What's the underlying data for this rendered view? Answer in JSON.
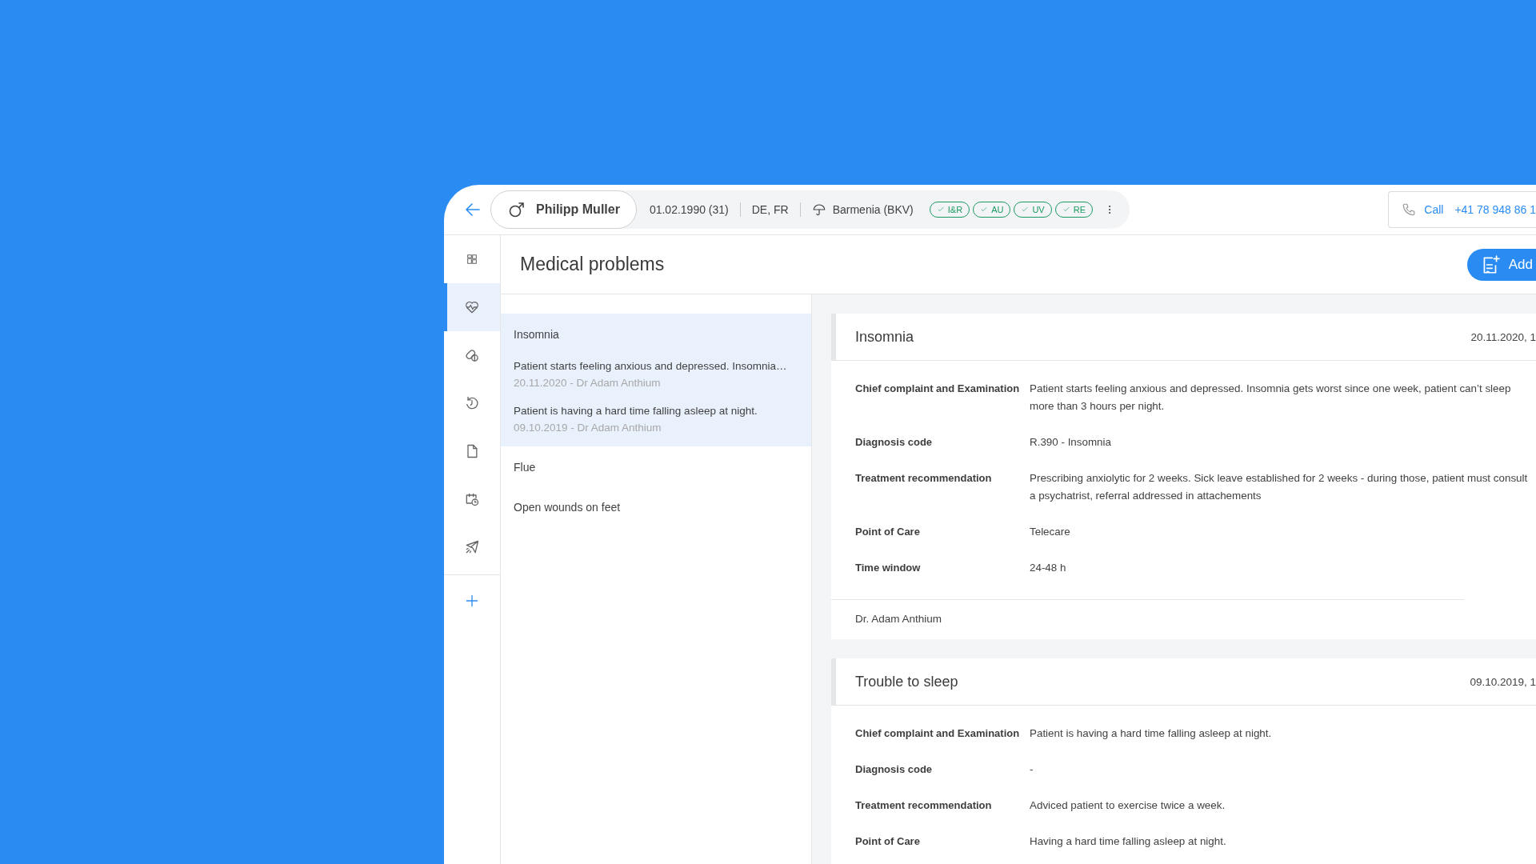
{
  "patient": {
    "name": "Philipp Muller",
    "birth": "01.02.1990 (31)",
    "languages": "DE, FR",
    "insurance": "Barmenia (BKV)",
    "badges": [
      "I&R",
      "AU",
      "UV",
      "RE"
    ]
  },
  "call": {
    "label": "Call",
    "number": "+41 78 948 86 1"
  },
  "sidebar": {
    "items": [
      {
        "kind": "dashboard",
        "selected": false
      },
      {
        "kind": "health",
        "selected": true
      },
      {
        "kind": "pills",
        "selected": false
      },
      {
        "kind": "history",
        "selected": false
      },
      {
        "kind": "document",
        "selected": false
      },
      {
        "kind": "schedule",
        "selected": false
      },
      {
        "kind": "travel",
        "selected": false
      }
    ]
  },
  "page": {
    "title": "Medical problems",
    "add_button": "Add"
  },
  "problems": [
    {
      "title": "Insomnia",
      "selected": true,
      "entries": [
        {
          "text": "Patient starts feeling anxious and depressed. Insomnia…",
          "meta": "20.11.2020 - Dr Adam Anthium"
        },
        {
          "text": "Patient is having a hard time falling asleep at night.",
          "meta": "09.10.2019 - Dr Adam Anthium"
        }
      ]
    },
    {
      "title": "Flue",
      "selected": false
    },
    {
      "title": "Open wounds on feet",
      "selected": false
    }
  ],
  "records": [
    {
      "title": "Insomnia",
      "date": "20.11.2020, 1",
      "author": "Dr. Adam Anthium",
      "fields": [
        {
          "label": "Chief complaint and Examination",
          "value": "Patient starts feeling anxious and depressed. Insomnia gets worst since one week, patient can’t sleep more than 3 hours per night."
        },
        {
          "label": "Diagnosis code",
          "value": "R.390 - Insomnia"
        },
        {
          "label": "Treatment recommendation",
          "value": "Prescribing anxiolytic for 2 weeks. Sick leave established for 2 weeks - during those, patient must consult a psychatrist, referral addressed in attachements"
        },
        {
          "label": "Point of Care",
          "value": "Telecare"
        },
        {
          "label": "Time window",
          "value": "24-48 h"
        }
      ]
    },
    {
      "title": "Trouble to sleep",
      "date": "09.10.2019, 1",
      "fields": [
        {
          "label": "Chief complaint and Examination",
          "value": "Patient is having a hard time falling asleep at night."
        },
        {
          "label": "Diagnosis code",
          "value": "-"
        },
        {
          "label": "Treatment recommendation",
          "value": "Adviced patient to exercise twice a week."
        },
        {
          "label": "Point of Care",
          "value": "Having a hard time falling asleep at night."
        }
      ]
    }
  ]
}
